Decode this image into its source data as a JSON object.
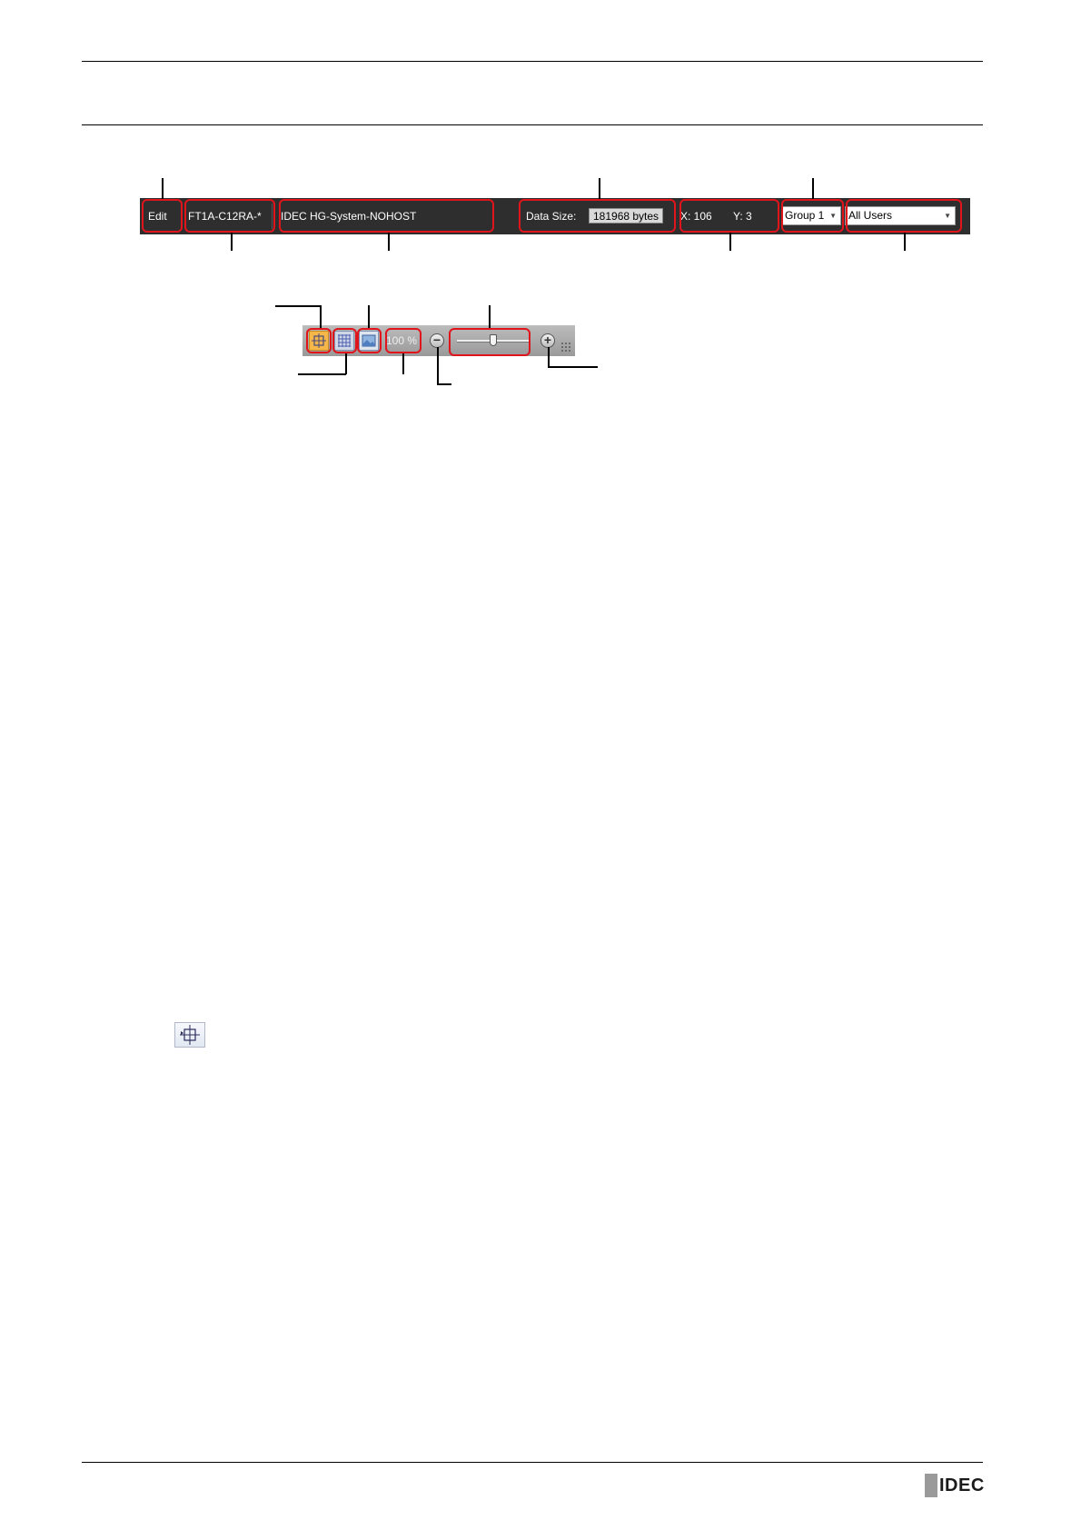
{
  "status_bar": {
    "mode": "Edit",
    "model": "FT1A-C12RA-*",
    "device": "IDEC HG-System-NOHOST",
    "data_size_label": "Data Size:",
    "data_size_value": "181968 bytes",
    "coord_x": "X: 106",
    "coord_y": "Y: 3",
    "group_select": "Group 1",
    "user_select": "All Users"
  },
  "zoom_toolbar": {
    "zoom_percent": "100 %",
    "zoom_out_symbol": "−",
    "zoom_in_symbol": "+",
    "slider_fraction": 0.5
  },
  "icons": [
    "snap-to-grid-icon",
    "grid-icon",
    "background-image-icon",
    "zoom-out-icon",
    "zoom-in-icon",
    "resize-grip-icon"
  ],
  "brand": {
    "logo_text": "IDEC"
  },
  "colors": {
    "highlight": "#e0141b",
    "statusbar_bg": "#2e2e2e",
    "snap_active": "#f5b64a"
  }
}
